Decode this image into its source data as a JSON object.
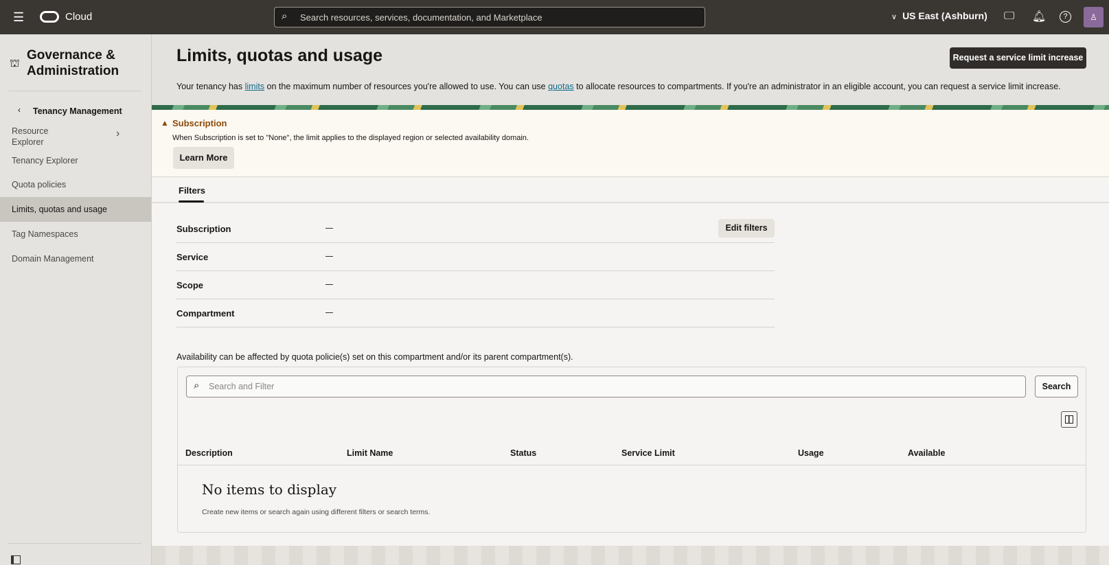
{
  "topbar": {
    "brand": "Cloud",
    "search_placeholder": "Search resources, services, documentation, and Marketplace",
    "region": "US East (Ashburn)",
    "icons": [
      "menu-icon",
      "oracle-logo",
      "search-icon",
      "chevron-down-icon",
      "cloud-shell-icon",
      "bell-icon",
      "help-icon",
      "avatar-icon"
    ]
  },
  "sidebar": {
    "title_line1": "Governance &",
    "title_line2": "Administration",
    "back_label": "Tenancy Management",
    "items": [
      {
        "label": "Resource",
        "label2": "Explorer"
      },
      {
        "label": "Tenancy Explorer"
      },
      {
        "label": "Quota policies"
      },
      {
        "label": "Limits, quotas and usage",
        "active": true
      },
      {
        "label": "Tag Namespaces"
      },
      {
        "label": "Domain Management"
      }
    ]
  },
  "header": {
    "title": "Limits, quotas and usage",
    "request_button": "Request a service limit increase",
    "desc_pre": "Your tenancy has ",
    "desc_link1": "limits",
    "desc_mid": " on the maximum number of resources you're allowed to use. You can use ",
    "desc_link2": "quotas",
    "desc_post": " to allocate resources to compartments. If you're an administrator in an eligible account, you can request a service limit increase."
  },
  "alert": {
    "title": "Subscription",
    "text": "When Subscription is set to \"None\", the limit applies to the displayed region or selected availability domain.",
    "button": "Learn More",
    "color": "#8a4b08"
  },
  "tabs": [
    {
      "label": "Filters",
      "active": true
    }
  ],
  "filters": {
    "edit_button": "Edit filters",
    "rows": [
      {
        "label": "Subscription",
        "value": "—"
      },
      {
        "label": "Service",
        "value": "—"
      },
      {
        "label": "Scope",
        "value": "—"
      },
      {
        "label": "Compartment",
        "value": "—"
      }
    ]
  },
  "availability_note": "Availability can be affected by quota policie(s) set on this compartment and/or its parent compartment(s).",
  "table": {
    "search_placeholder": "Search and Filter",
    "search_button": "Search",
    "columns": [
      "Description",
      "Limit Name",
      "Status",
      "Service Limit",
      "Usage",
      "Available"
    ],
    "empty_title": "No items to display",
    "empty_text": "Create new items or search again using different filters or search terms."
  }
}
